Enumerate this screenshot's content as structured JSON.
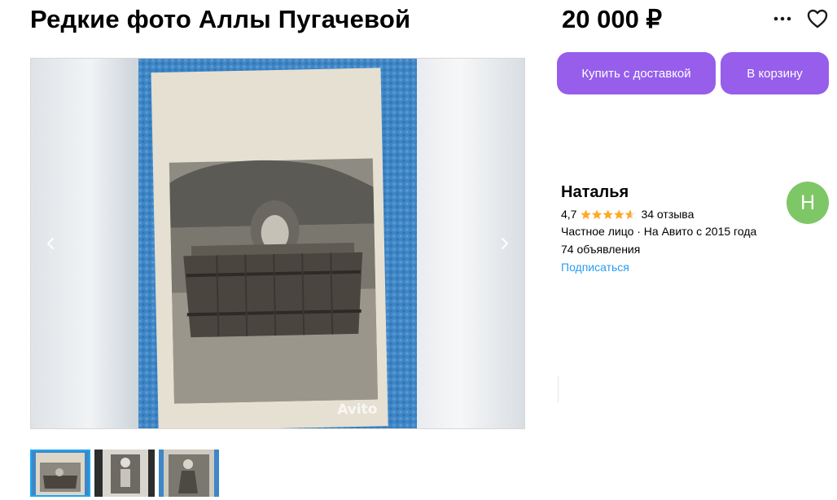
{
  "listing": {
    "title": "Редкие фото Аллы Пугачевой",
    "price": "20 000 ₽"
  },
  "actions": {
    "buy_delivery_label": "Купить с доставкой",
    "cart_label": "В корзину",
    "more_icon": "more-dots-icon",
    "favorite_icon": "heart-icon"
  },
  "gallery": {
    "watermark": "Avito",
    "thumbnails_count": 3,
    "selected_index": 0
  },
  "seller": {
    "name": "Наталья",
    "rating": "4,7",
    "stars_out_of_5": 4.7,
    "reviews": "34 отзыва",
    "type_and_since": "Частное лицо · На Авито с 2015 года",
    "ads_count": "74 объявления",
    "subscribe_label": "Подписаться",
    "avatar_letter": "Н"
  },
  "colors": {
    "accent_purple": "#965eeb",
    "link_blue": "#2a9cf2",
    "star_orange": "#ffa928",
    "avatar_green": "#7ec766",
    "selected_thumb_border": "#1ea7f0"
  }
}
